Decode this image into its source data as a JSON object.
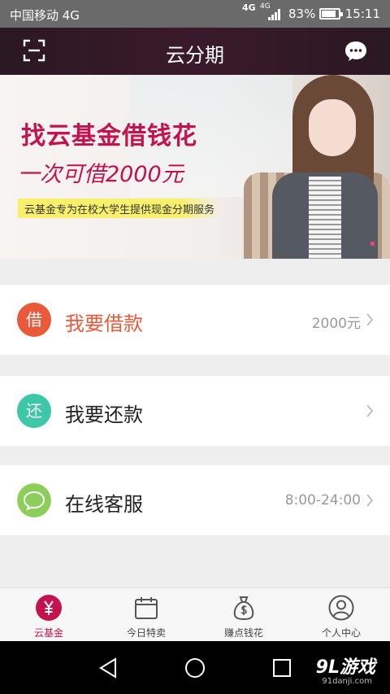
{
  "status_bar": {
    "carrier": "中国移动 4G",
    "network_primary": "4G",
    "network_secondary": "4G",
    "battery_percent": "83%",
    "battery_level": 0.83,
    "time": "15:11"
  },
  "header": {
    "title": "云分期",
    "left_icon": "scan-icon",
    "right_icon": "chat-icon"
  },
  "banner": {
    "headline": "找云基金借钱花",
    "subheadline": "一次可借2000元",
    "tagline": "云基金专为在校大学生提供现金分期服务"
  },
  "menu": {
    "borrow": {
      "badge": "借",
      "label": "我要借款",
      "value": "2000元",
      "badge_color": "#e85a3a",
      "label_color": "#e85a3a"
    },
    "repay": {
      "badge": "还",
      "label": "我要还款",
      "value": "",
      "badge_color": "#3dc7a8"
    },
    "service": {
      "label": "在线客服",
      "value": "8:00-24:00",
      "badge_color": "#8bcf5a"
    }
  },
  "bottom_nav": {
    "items": [
      {
        "label": "云基金",
        "icon": "yen-icon",
        "active": true
      },
      {
        "label": "今日特卖",
        "icon": "calendar-icon",
        "active": false
      },
      {
        "label": "赚点钱花",
        "icon": "money-bag-icon",
        "active": false
      },
      {
        "label": "个人中心",
        "icon": "person-icon",
        "active": false
      }
    ]
  },
  "watermark": {
    "brand": "9L游戏",
    "domain": "91danji.com"
  },
  "colors": {
    "accent": "#c4124f",
    "header_bg": "#2f1a26"
  }
}
